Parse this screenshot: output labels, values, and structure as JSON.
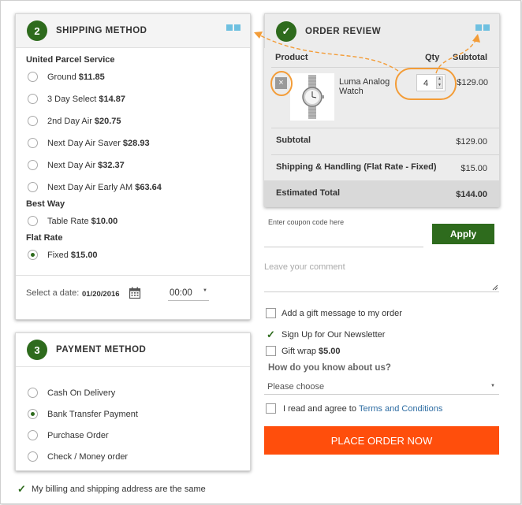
{
  "shipping": {
    "step": "2",
    "title": "SHIPPING METHOD",
    "groups": [
      {
        "name": "United Parcel Service",
        "options": [
          {
            "label": "Ground",
            "price": "$11.85",
            "selected": false
          },
          {
            "label": "3 Day Select",
            "price": "$14.87",
            "selected": false
          },
          {
            "label": "2nd Day Air",
            "price": "$20.75",
            "selected": false
          },
          {
            "label": "Next Day Air Saver",
            "price": "$28.93",
            "selected": false
          },
          {
            "label": "Next Day Air",
            "price": "$32.37",
            "selected": false
          },
          {
            "label": "Next Day Air Early AM",
            "price": "$63.64",
            "selected": false
          }
        ]
      },
      {
        "name": "Best Way",
        "options": [
          {
            "label": "Table Rate",
            "price": "$10.00",
            "selected": false
          }
        ]
      },
      {
        "name": "Flat Rate",
        "options": [
          {
            "label": "Fixed",
            "price": "$15.00",
            "selected": true
          }
        ]
      }
    ],
    "date_label": "Select a date:",
    "date_value": "01/20/2016",
    "time_value": "00:00"
  },
  "payment": {
    "step": "3",
    "title": "PAYMENT METHOD",
    "options": [
      {
        "label": "Cash On Delivery",
        "selected": false
      },
      {
        "label": "Bank Transfer Payment",
        "selected": true
      },
      {
        "label": "Purchase Order",
        "selected": false
      },
      {
        "label": "Check / Money order",
        "selected": false
      }
    ]
  },
  "billing_same": "My billing and shipping address are the same",
  "review": {
    "step": "✓",
    "title": "ORDER REVIEW",
    "col_product": "Product",
    "col_qty": "Qty",
    "col_subtotal": "Subtotal",
    "item": {
      "name": "Luma Analog Watch",
      "qty": "4",
      "subtotal": "$129.00"
    },
    "subtotal_label": "Subtotal",
    "subtotal_value": "$129.00",
    "shipping_label": "Shipping & Handling (Flat Rate - Fixed)",
    "shipping_value": "$15.00",
    "total_label": "Estimated Total",
    "total_value": "$144.00"
  },
  "coupon": {
    "placeholder": "Enter coupon code here",
    "apply_label": "Apply"
  },
  "comment": {
    "placeholder": "Leave your comment"
  },
  "options": {
    "gift_message": "Add a gift message to my order",
    "newsletter": "Sign Up for Our Newsletter",
    "gift_wrap_label": "Gift wrap",
    "gift_wrap_price": "$5.00",
    "survey_question": "How do you know about us?",
    "survey_select": "Please choose",
    "terms_prefix": "I read and agree to",
    "terms_link": "Terms and Conditions"
  },
  "place_order": "PLACE ORDER NOW",
  "colors": {
    "green": "#2e6b1d",
    "orange": "#ff4e0c",
    "highlight": "#f39c37",
    "dots": "#6fc0e0"
  }
}
